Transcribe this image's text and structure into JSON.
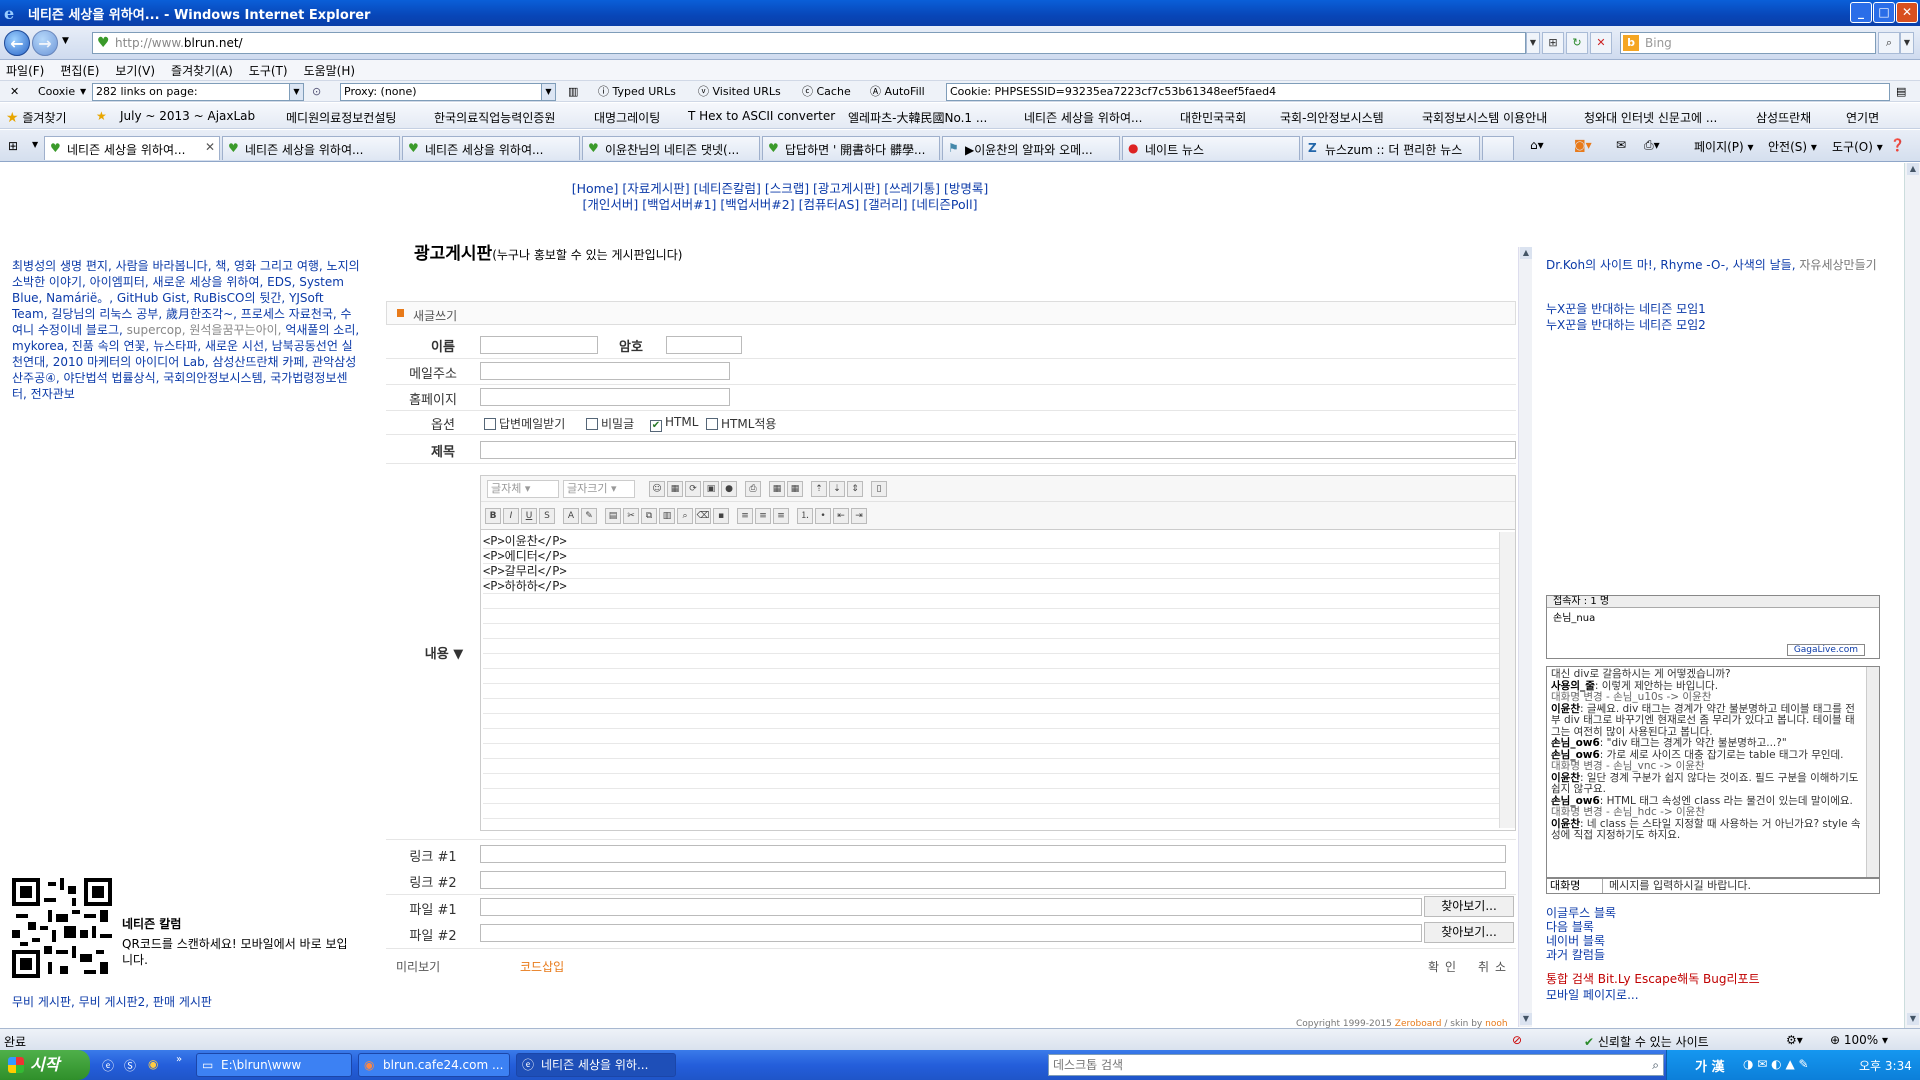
{
  "window": {
    "title": "네티즌 세상을 위하여... - Windows Internet Explorer",
    "min": "_",
    "max": "□",
    "close": "✕"
  },
  "address": {
    "url_prefix": "http://www.",
    "url_domain": "blrun.net/",
    "search_placeholder": "Bing"
  },
  "menu": [
    "파일(F)",
    "편집(E)",
    "보기(V)",
    "즐겨찾기(A)",
    "도구(T)",
    "도움말(H)"
  ],
  "toolbar": {
    "close_x": "✕",
    "cooxie": "Cooxie",
    "links_combo": "282 links on page:",
    "proxy_combo": "Proxy: (none)",
    "typed_urls": "Typed URLs",
    "visited_urls": "Visited URLs",
    "cache": "Cache",
    "autofill": "AutoFill",
    "cookie": "Cookie: PHPSESSID=93235ea7223cf7c53b61348eef5faed4"
  },
  "favorites": {
    "label": "즐겨찾기",
    "items": [
      "July ~ 2013 ~ AjaxLab",
      "메디원의료정보컨설팅",
      "한국의료직업능력인증원",
      "대명그레이팅",
      "T Hex to ASCII converter",
      "엘레파츠-大韓民國No.1 ...",
      "네티즌 세상을 위하여...",
      "대한민국국회",
      "국회-의안정보시스템",
      "국회정보시스템 이용안내",
      "청와대 인터넷 신문고에 ...",
      "삼성뜨란채",
      "연기면"
    ]
  },
  "tabs": [
    "네티즌 세상을 위하여...",
    "네티즌 세상을 위하여...",
    "네티즌 세상을 위하여...",
    "이윤찬님의 네티즌 댓넷(...",
    "답답하면 ' 開書하다 髒學...",
    "▶이윤찬의 알파와 오메...",
    "네이트 뉴스",
    "뉴스zum :: 더 편리한 뉴스"
  ],
  "commandbar": {
    "page": "페이지(P)",
    "safety": "안전(S)",
    "tools": "도구(O)"
  },
  "topnav": {
    "line1": "[Home] [자료게시판] [네티즌칼럼] [스크랩] [광고게시판] [쓰레기통] [방명록]",
    "line2": "[개인서버] [백업서버#1] [백업서버#2] [컴퓨터AS] [갤러리] [네티즌Poll]"
  },
  "left": {
    "links": "최병성의 생명 편지, 사람을 바라봅니다, 책, 영화 그리고 여행, 노지의 소박한 이야기, 아이엠피터, 새로운 세상을 위하여, EDS, System Blue, Namárië。, GitHub Gist, RuBisCO의 뒷간, YJSoft Team, 길당님의 리눅스 공부, 歲月한조각~, 프로세스 자료천국, 수여니 수정이네 블로그,",
    "links_gray": "supercop, 원석을꿈꾸는아이,",
    "links_tail": "억새풀의 소리, mykorea, 진품 속의 연꽃, 뉴스타파, 새로운 시선, 남북공동선언 실천연대, 2010 마케터의 아이디어 Lab, 삼성산뜨란채 카페, 관악삼성산주공④, 야단법석 법률상식, 국회의안정보시스템, 국가법령정보센터, 전자관보",
    "qr_title": "네티즌 칼럼",
    "qr_text": "QR코드를 스캔하세요! 모바일에서 바로 보입니다.",
    "bottom_links": "무비 게시판, 무비 게시판2, 판매 게시판"
  },
  "board": {
    "title": "광고게시판",
    "subtitle": "(누구나 홍보할 수 있는 게시판입니다)",
    "newpost": "새글쓰기",
    "name_label": "이름",
    "password_label": "암호",
    "email_label": "메일주소",
    "homepage_label": "홈페이지",
    "options_label": "옵션",
    "opt_reply_mail": "답변메일받기",
    "opt_secret": "비밀글",
    "opt_html": "HTML",
    "opt_html_apply": "HTML적용",
    "subject_label": "제목",
    "content_label": "내용 ▼",
    "font_select": "글자체",
    "size_select": "글자크기",
    "content_lines": [
      "<P>이윤찬</P>",
      "<P>에디터</P>",
      "<P>갈무리</P>",
      "<P>하하하</P>"
    ],
    "link1_label": "링크 #1",
    "link2_label": "링크 #2",
    "file1_label": "파일 #1",
    "file2_label": "파일 #2",
    "browse": "찾아보기...",
    "preview": "미리보기",
    "code_insert": "코드삽입",
    "confirm": "확인",
    "cancel": "취소",
    "copyright": "Copyright 1999-2015",
    "zeroboard": "Zeroboard",
    "skin": "/ skin by",
    "skin_author": "nooh"
  },
  "right": {
    "links1": "Dr.Koh의 사이트 마!, Rhyme -O-, 사색의 날들,",
    "links1_gray": "자유세상만들기",
    "links2": [
      "누X꾼을 반대하는 네티즌 모임1",
      "누X꾼을 반대하는 네티즌 모임2"
    ],
    "chat_header": "접속자 : 1 명",
    "chat_user": "손님_nua",
    "gagalive": "GagaLive.com",
    "chat_log": [
      {
        "who": "",
        "msg": "대신 div로 갈음하시는 게 어떻겠습니까?"
      },
      {
        "who": "사용의_줄",
        "msg": ": 이렇게 제안하는 바입니다."
      },
      {
        "who": "",
        "msg": "대화명 변경 - 손님_u10s -> 이윤찬"
      },
      {
        "who": "이윤찬",
        "msg": ": 글쎄요. div 태그는 경계가 약간 불분명하고 테이블 태그를 전부 div 태그로 바꾸기엔 현재로선 좀 무리가 있다고 봅니다. 테이블 태그는 여전히 많이 사용된다고 봅니다."
      },
      {
        "who": "손님_ow6",
        "msg": ": \"div 태그는 경계가 약간 불분명하고...?\""
      },
      {
        "who": "손님_ow6",
        "msg": ": 가로 세로 사이즈 대충 잡기로는 table 태그가 무인데."
      },
      {
        "who": "",
        "msg": "대화명 변경 - 손님_vnc -> 이윤찬"
      },
      {
        "who": "이윤찬",
        "msg": ": 일단 경계 구분가 쉽지 않다는 것이죠. 필드 구분을 이해하기도 쉽지 않구요."
      },
      {
        "who": "손님_ow6",
        "msg": ": HTML 태그 속성엔 class 라는 물건이 있는데 말이에요."
      },
      {
        "who": "",
        "msg": "대화명 변경 - 손님_hdc -> 이윤찬"
      },
      {
        "who": "이윤찬",
        "msg": ": 네 class 는 스타일 지정할 때 사용하는 거 아닌가요? style 속성에 직접 지정하기도 하지요."
      }
    ],
    "chat_nick": "대화명",
    "chat_placeholder": "메시지를 입력하시길 바랍니다.",
    "links3": [
      "이글루스 블록",
      "다음 블록",
      "네이버 블록",
      "과거 칼럼들"
    ],
    "links4_red": "통합 검색 Bit.Ly Escape해독 Bug리포트",
    "links4": "모바일 페이지로..."
  },
  "status": {
    "done": "완료",
    "trusted": "신뢰할 수 있는 사이트",
    "zoom": "100%"
  },
  "taskbar": {
    "start": "시작",
    "tasks": [
      "E:\\blrun\\www",
      "blrun.cafe24.com ...",
      "네티즌 세상을 위하..."
    ],
    "desktop_search": "데스크톱 검색",
    "ime": "가 漢",
    "clock": "오후 3:34"
  }
}
